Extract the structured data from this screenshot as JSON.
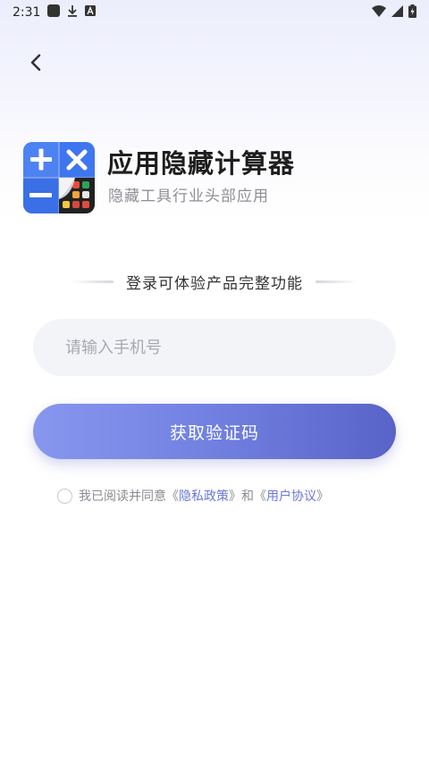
{
  "status_bar": {
    "time": "2:31",
    "icons": [
      "app-notification-icon",
      "download-icon",
      "text-a-icon"
    ],
    "right_icons": [
      "wifi-icon",
      "signal-icon",
      "battery-icon"
    ]
  },
  "nav": {
    "back_icon": "chevron-left-icon"
  },
  "app": {
    "logo_icon": "calculator-logo-icon",
    "title": "应用隐藏计算器",
    "subtitle": "隐藏工具行业头部应用"
  },
  "login": {
    "divider_text": "登录可体验产品完整功能",
    "phone_placeholder": "请输入手机号",
    "phone_value": "",
    "code_button_label": "获取验证码"
  },
  "agreement": {
    "prefix": "我已阅读并同意",
    "open_bracket_1": "《",
    "privacy_label": "隐私政策",
    "close_bracket_1": "》",
    "conjunction": "和",
    "open_bracket_2": "《",
    "user_agreement_label": "用户协议",
    "close_bracket_2": "》",
    "checked": false
  },
  "colors": {
    "accent": "#6a77d8",
    "button_start": "#8797ef",
    "button_end": "#5963c8",
    "logo_blue": "#4a7df0"
  }
}
